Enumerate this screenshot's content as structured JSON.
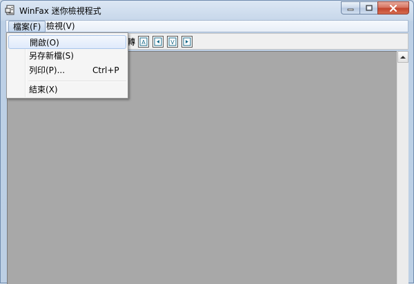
{
  "window": {
    "title": "WinFax 迷你檢視程式"
  },
  "menubar": {
    "items": [
      {
        "label": "檔案(F)"
      },
      {
        "label": "檢視(V)"
      }
    ]
  },
  "file_menu": {
    "items": [
      {
        "label": "開啟(O)",
        "shortcut": ""
      },
      {
        "label": "另存新檔(S)",
        "shortcut": ""
      },
      {
        "label": "列印(P)...",
        "shortcut": "Ctrl+P"
      },
      {
        "label": "結束(X)",
        "shortcut": ""
      }
    ],
    "highlighted_index": 0
  },
  "toolbar": {
    "partial_text": "轉",
    "buttons": [
      {
        "icon": "page-a-icon"
      },
      {
        "icon": "page-left-icon"
      },
      {
        "icon": "page-v-icon"
      },
      {
        "icon": "page-right-icon"
      }
    ]
  },
  "colors": {
    "canvas": "#a8a8a8",
    "close_button": "#c1432b"
  }
}
